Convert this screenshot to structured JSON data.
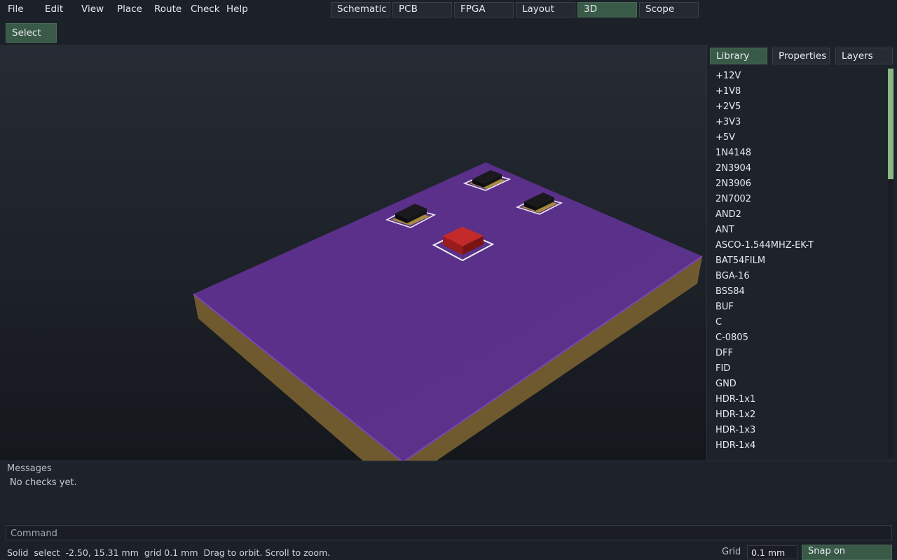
{
  "menu": [
    "File",
    "Edit",
    "View",
    "Place",
    "Route",
    "Check",
    "Help"
  ],
  "mode_tabs": [
    "Schematic",
    "PCB",
    "FPGA",
    "Layout",
    "3D",
    "Scope"
  ],
  "active_mode": "3D",
  "tool": {
    "select_label": "Select"
  },
  "side_tabs": [
    "Library",
    "Properties",
    "Layers"
  ],
  "active_side_tab": "Library",
  "library": [
    "+12V",
    "+1V8",
    "+2V5",
    "+3V3",
    "+5V",
    "1N4148",
    "2N3904",
    "2N3906",
    "2N7002",
    "AND2",
    "ANT",
    "ASCO-1.544MHZ-EK-T",
    "BAT54FILM",
    "BGA-16",
    "BSS84",
    "BUF",
    "C",
    "C-0805",
    "DFF",
    "FID",
    "GND",
    "HDR-1x1",
    "HDR-1x2",
    "HDR-1x3",
    "HDR-1x4"
  ],
  "messages": {
    "title": "Messages",
    "body": "No checks yet."
  },
  "command": {
    "placeholder": "Command"
  },
  "status": {
    "text": "Solid  select  -2.50, 15.31 mm  grid 0.1 mm  Drag to orbit. Scroll to zoom.",
    "grid_label": "Grid",
    "grid_value": "0.1 mm",
    "snap_label": "Snap on"
  },
  "colors": {
    "board_top": "#5a2f88",
    "board_edge": "#6e5a2e",
    "accent": "#3a5a48",
    "selected_part": "#b02020"
  }
}
